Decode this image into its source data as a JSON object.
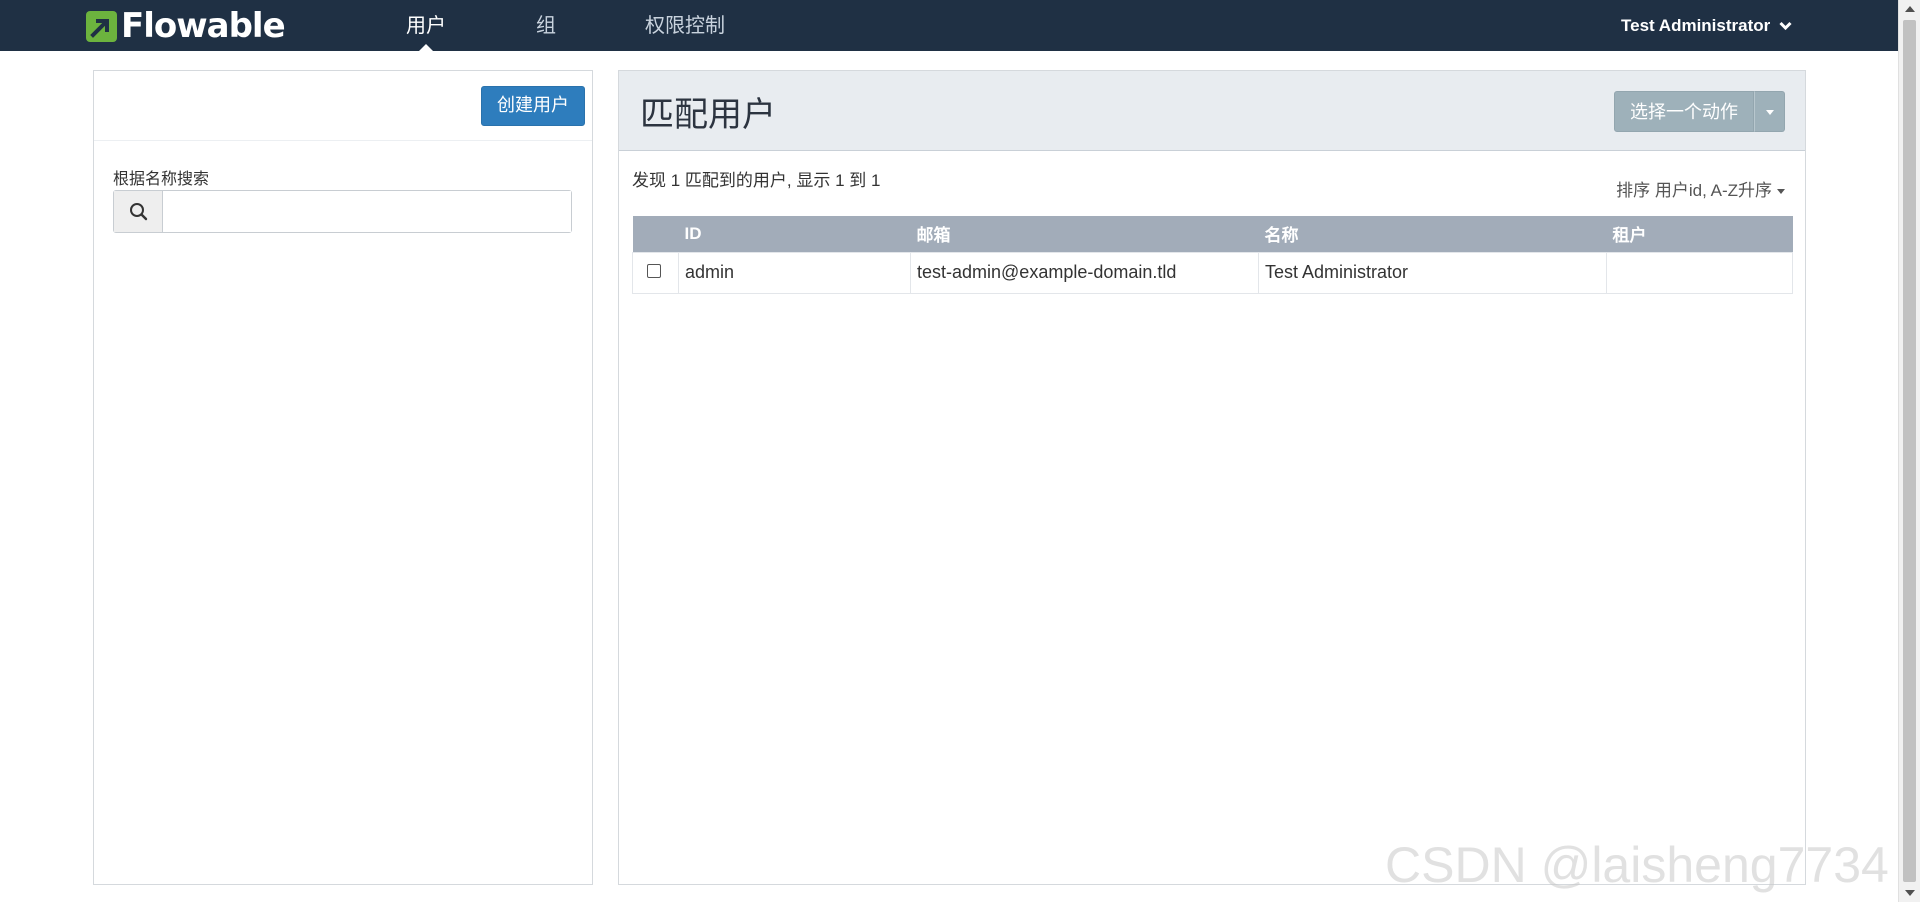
{
  "navbar": {
    "logo_text": "Flowable",
    "tabs": [
      {
        "label": "用户",
        "active": true
      },
      {
        "label": "组",
        "active": false
      },
      {
        "label": "权限控制",
        "active": false
      }
    ],
    "user_menu": "Test Administrator",
    "user_menu_icon": "chevron-down-icon"
  },
  "left": {
    "create_button": "创建用户",
    "search_label": "根据名称搜索",
    "search_value": "",
    "search_icon": "search-icon"
  },
  "right": {
    "title": "匹配用户",
    "action_button": "选择一个动作",
    "result_info": "发现 1 匹配到的用户, 显示 1 到 1",
    "sort_label": "排序 用户id, A-Z升序",
    "table": {
      "headers": [
        "",
        "ID",
        "邮箱",
        "名称",
        "租户"
      ],
      "rows": [
        {
          "checked": false,
          "id": "admin",
          "email": "test-admin@example-domain.tld",
          "name": "Test Administrator",
          "tenant": ""
        }
      ]
    }
  },
  "watermark": "CSDN @laisheng7734",
  "colors": {
    "navbar_bg": "#1f3044",
    "logo_green": "#6cb33e",
    "primary_button": "#2e7dbd",
    "action_button": "#9eb1ba",
    "table_header": "#a2acb9",
    "panel_header": "#e8ecf0"
  }
}
